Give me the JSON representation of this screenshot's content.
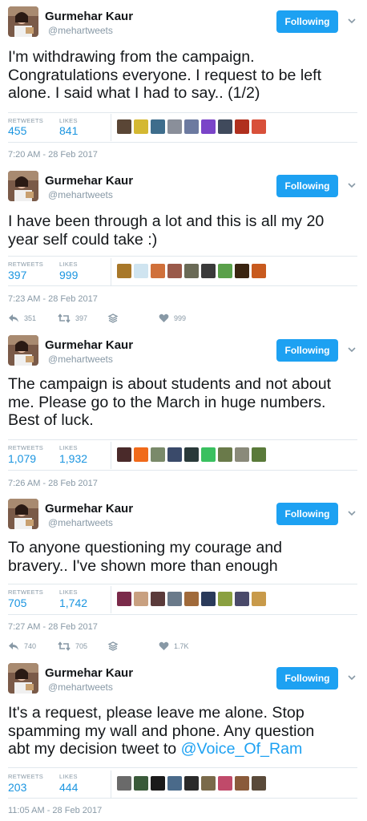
{
  "author": {
    "name": "Gurmehar Kaur",
    "handle": "@mehartweets"
  },
  "follow_label": "Following",
  "stat_labels": {
    "retweets": "RETWEETS",
    "likes": "LIKES"
  },
  "colors": {
    "accent": "#1da1f2",
    "link": "#1b95e0",
    "muted": "#8899a6",
    "divider": "#e1e8ed"
  },
  "icons": {
    "reply": "reply-icon",
    "retweet": "retweet-icon",
    "stack": "stack-icon",
    "like": "heart-icon",
    "menu": "chevron-down-icon"
  },
  "tweets": [
    {
      "lines": [
        "I'm withdrawing from the campaign.",
        "Congratulations everyone. I request to be left",
        "alone. I said what I had to say.. (1/2)"
      ],
      "retweets": "455",
      "likes": "841",
      "timestamp": "7:20 AM - 28 Feb 2017",
      "liker_colors": [
        "#5a4636",
        "#d4b832",
        "#3e6d8c",
        "#8a8f9a",
        "#6c7aa0",
        "#7a44c8",
        "#404a5c",
        "#b0301e",
        "#d8503a"
      ]
    },
    {
      "lines": [
        "I have been through a lot and this is all my 20",
        "year self could take :)"
      ],
      "retweets": "397",
      "likes": "999",
      "timestamp": "7:23 AM - 28 Feb 2017",
      "actions": {
        "replies": "351",
        "retweets": "397",
        "likes": "999"
      },
      "liker_colors": [
        "#a8782a",
        "#cfe4f0",
        "#d0703a",
        "#9a5a4a",
        "#6a6a56",
        "#3a3a3a",
        "#5aa04a",
        "#3a2410",
        "#c85a1e"
      ]
    },
    {
      "lines": [
        "The campaign is about students and not about",
        "me. Please go to the March in huge numbers.",
        "Best of luck."
      ],
      "retweets": "1,079",
      "likes": "1,932",
      "timestamp": "7:26 AM - 28 Feb 2017",
      "liker_colors": [
        "#4a2a2a",
        "#f06a1a",
        "#7a8a6a",
        "#3a4a6a",
        "#2a3a3a",
        "#3ac060",
        "#6a7a4a",
        "#8a8a7a",
        "#5a7a3a"
      ]
    },
    {
      "lines": [
        "To anyone questioning my courage and",
        "bravery.. I've shown more than enough"
      ],
      "retweets": "705",
      "likes": "1,742",
      "timestamp": "7:27 AM - 28 Feb 2017",
      "actions": {
        "replies": "740",
        "retweets": "705",
        "likes": "1.7K"
      },
      "liker_colors": [
        "#7a2a4a",
        "#c8a080",
        "#5a3a3a",
        "#6a7a8a",
        "#a06a3a",
        "#2a3a5a",
        "#8aa040",
        "#4a4a6a",
        "#c89a4a"
      ]
    },
    {
      "lines": [
        "It's a request, please leave me alone. Stop",
        "spamming my wall and phone. Any question"
      ],
      "last_line_prefix": "abt my decision tweet to ",
      "mention": "@Voice_Of_Ram",
      "retweets": "203",
      "likes": "444",
      "timestamp": "11:05 AM - 28 Feb 2017",
      "liker_colors": [
        "#6a6a6a",
        "#3a5a3a",
        "#1a1a1a",
        "#4a6a8a",
        "#2a2a2a",
        "#7a6a4a",
        "#c04a6a",
        "#8a5a3a",
        "#5a4a3a"
      ]
    }
  ]
}
